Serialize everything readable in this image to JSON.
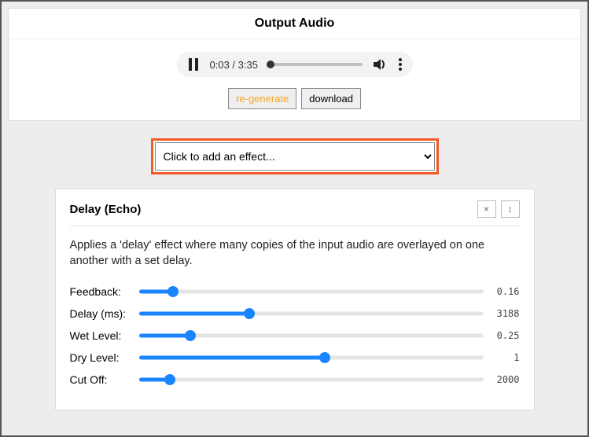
{
  "output": {
    "title": "Output Audio",
    "time": "0:03 / 3:35",
    "progress_pct": 2,
    "regenerate_label": "re-generate",
    "download_label": "download"
  },
  "effect_select": {
    "placeholder": "Click to add an effect..."
  },
  "effect": {
    "title": "Delay (Echo)",
    "description": "Applies a 'delay' effect where many copies of the input audio are overlayed on one another with a set delay.",
    "params": [
      {
        "label": "Feedback:",
        "value": "0.16",
        "pct": 10
      },
      {
        "label": "Delay (ms):",
        "value": "3188",
        "pct": 32
      },
      {
        "label": "Wet Level:",
        "value": "0.25",
        "pct": 15
      },
      {
        "label": "Dry Level:",
        "value": "1",
        "pct": 54
      },
      {
        "label": "Cut Off:",
        "value": "2000",
        "pct": 9
      }
    ]
  }
}
